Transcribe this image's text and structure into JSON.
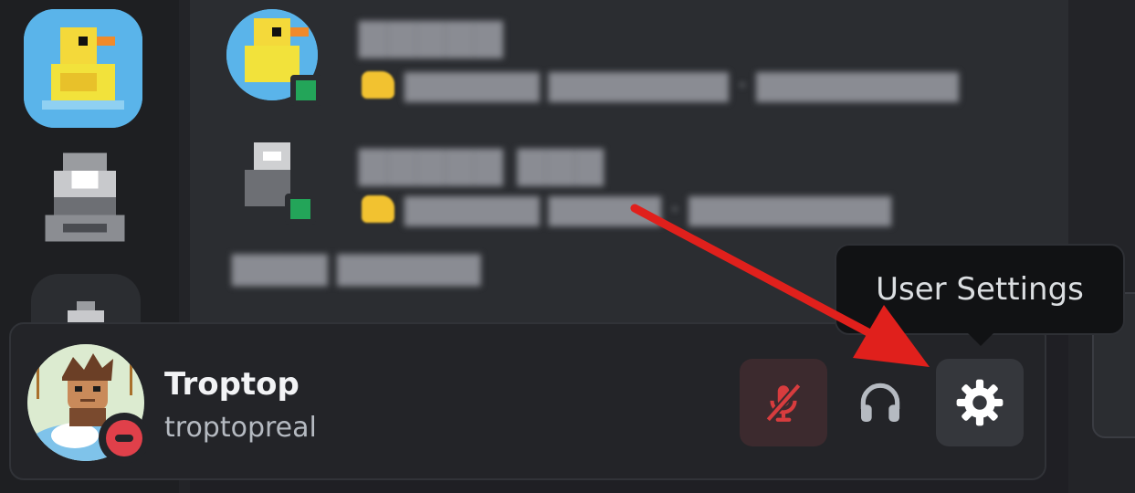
{
  "user_panel": {
    "display_name": "Troptop",
    "username": "troptopreal",
    "status": "do-not-disturb"
  },
  "controls": {
    "mute_icon": "microphone-muted-icon",
    "deafen_icon": "headphones-icon",
    "settings_icon": "gear-icon"
  },
  "tooltip": {
    "text": "User Settings"
  },
  "colors": {
    "accent_red_annotation": "#e0201c",
    "status_dnd": "#e0404a",
    "status_online": "#23a559"
  }
}
